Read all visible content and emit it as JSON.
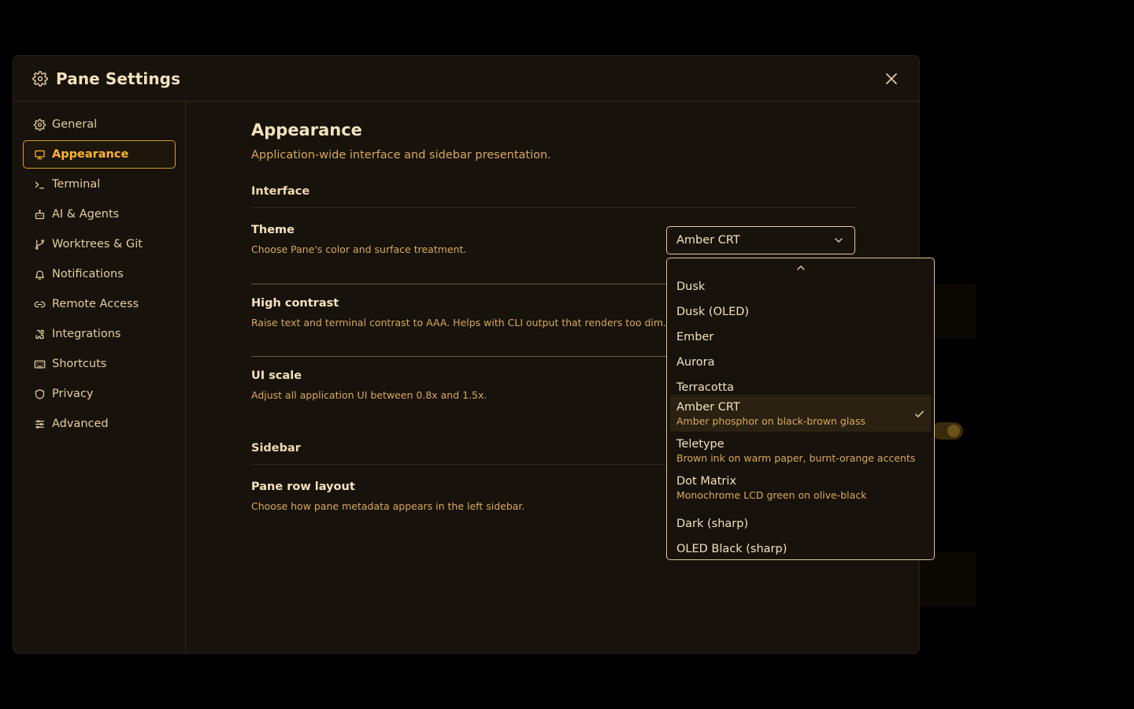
{
  "window": {
    "title": "Pane Settings",
    "close_label": "Close"
  },
  "sidebar": {
    "items": [
      {
        "label": "General",
        "icon": "gear-icon"
      },
      {
        "label": "Appearance",
        "icon": "monitor-icon",
        "active": true
      },
      {
        "label": "Terminal",
        "icon": "terminal-prompt-icon"
      },
      {
        "label": "AI & Agents",
        "icon": "robot-icon"
      },
      {
        "label": "Worktrees & Git",
        "icon": "git-branch-icon"
      },
      {
        "label": "Notifications",
        "icon": "bell-icon"
      },
      {
        "label": "Remote Access",
        "icon": "link-icon"
      },
      {
        "label": "Integrations",
        "icon": "puzzle-icon"
      },
      {
        "label": "Shortcuts",
        "icon": "keyboard-icon"
      },
      {
        "label": "Privacy",
        "icon": "shield-icon"
      },
      {
        "label": "Advanced",
        "icon": "sliders-icon"
      }
    ]
  },
  "main": {
    "title": "Appearance",
    "subtitle": "Application-wide interface and sidebar presentation.",
    "sections": {
      "interface": "Interface",
      "sidebar": "Sidebar"
    },
    "rows": {
      "theme": {
        "title": "Theme",
        "desc": "Choose Pane's color and surface treatment."
      },
      "high_contrast": {
        "title": "High contrast",
        "desc": "Raise text and terminal contrast to AAA. Helps with CLI output that renders too dim."
      },
      "ui_scale": {
        "title": "UI scale",
        "desc": "Adjust all application UI between 0.8x and 1.5x."
      },
      "pane_row_layout": {
        "title": "Pane row layout",
        "desc": "Choose how pane metadata appears in the left sidebar."
      }
    }
  },
  "theme_select": {
    "value": "Amber CRT",
    "options": [
      {
        "label": "Dusk",
        "desc": ""
      },
      {
        "label": "Dusk (OLED)",
        "desc": ""
      },
      {
        "label": "Ember",
        "desc": ""
      },
      {
        "label": "Aurora",
        "desc": ""
      },
      {
        "label": "Terracotta",
        "desc": ""
      },
      {
        "label": "Amber CRT",
        "desc": "Amber phosphor on black-brown glass",
        "selected": true
      },
      {
        "label": "Teletype",
        "desc": "Brown ink on warm paper, burnt-orange accents"
      },
      {
        "label": "Dot Matrix",
        "desc": "Monochrome LCD green on olive-black"
      },
      {
        "label": "Dark (sharp)",
        "desc": ""
      },
      {
        "label": "OLED Black (sharp)",
        "desc": ""
      }
    ]
  },
  "colors": {
    "accent": "#ffb32d",
    "text": "#f4e2bd",
    "muted": "#d9a85a",
    "surface": "#17120b",
    "backdrop": "#000000"
  }
}
